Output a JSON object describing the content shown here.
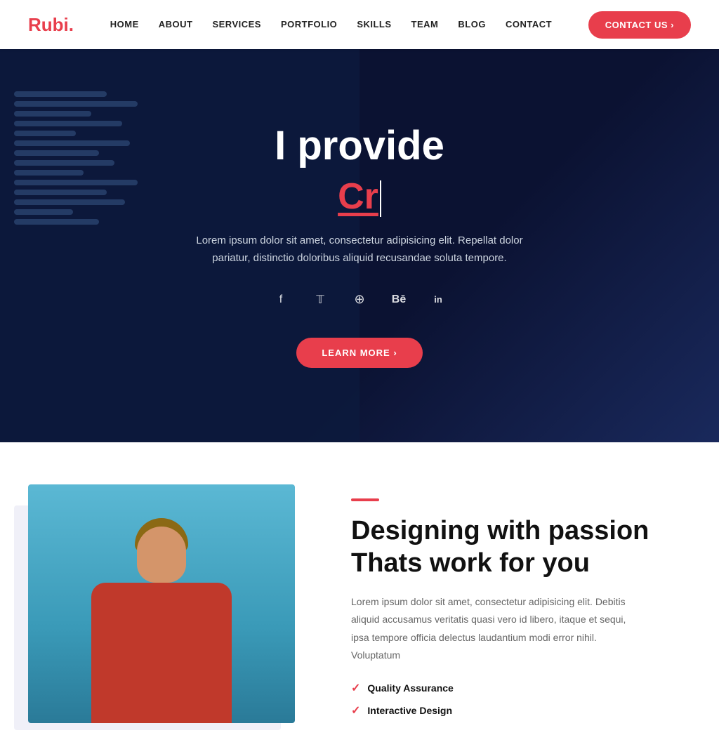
{
  "logo": {
    "highlight": "R",
    "rest": "ubi."
  },
  "navbar": {
    "links": [
      {
        "label": "HOME",
        "id": "home"
      },
      {
        "label": "ABOUT",
        "id": "about"
      },
      {
        "label": "SERVICES",
        "id": "services"
      },
      {
        "label": "PORTFOLIO",
        "id": "portfolio"
      },
      {
        "label": "SKILLS",
        "id": "skills"
      },
      {
        "label": "TEAM",
        "id": "team"
      },
      {
        "label": "BLOG",
        "id": "blog"
      },
      {
        "label": "CONTACT",
        "id": "contact"
      }
    ],
    "cta_label": "CONTACT US ›"
  },
  "hero": {
    "title": "I provide",
    "typed_text": "Cr",
    "description": "Lorem ipsum dolor sit amet, consectetur adipisicing elit. Repellat dolor pariatur, distinctio doloribus aliquid recusandae soluta tempore.",
    "learn_more_label": "LEARN MORE  ›",
    "social": [
      {
        "name": "facebook",
        "symbol": "f"
      },
      {
        "name": "twitter",
        "symbol": "𝕏"
      },
      {
        "name": "dribbble",
        "symbol": "⊕"
      },
      {
        "name": "behance",
        "symbol": "ℬ"
      },
      {
        "name": "linkedin",
        "symbol": "in"
      }
    ]
  },
  "about": {
    "accent": "",
    "heading": "Designing with passion Thats work for you",
    "description": "Lorem ipsum dolor sit amet, consectetur adipisicing elit. Debitis aliquid accusamus veritatis quasi vero id libero, itaque et sequi, ipsa tempore officia delectus laudantium modi error nihil. Voluptatum",
    "features": [
      {
        "label": "Quality Assurance"
      },
      {
        "label": "Interactive Design"
      }
    ]
  }
}
